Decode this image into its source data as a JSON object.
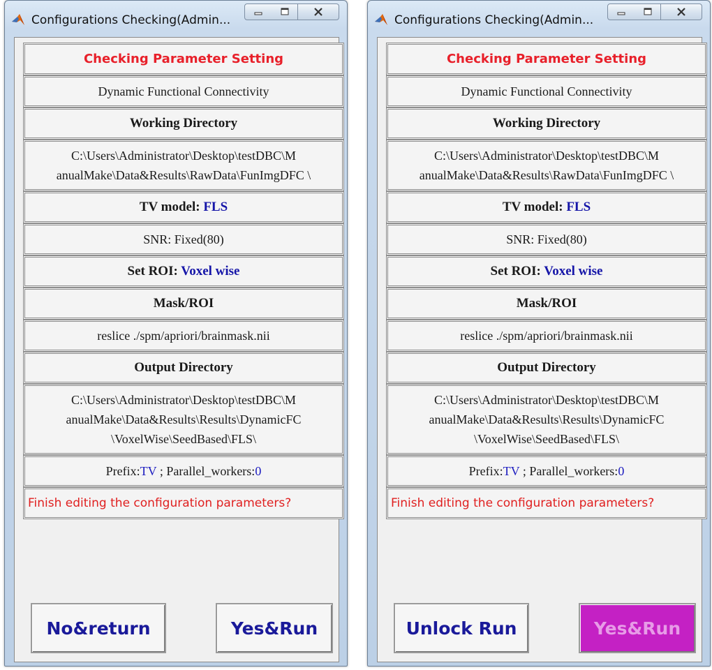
{
  "windows": [
    {
      "title": "Configurations Checking(Admin...",
      "header": "Checking Parameter Setting",
      "analysis_type": "Dynamic Functional Connectivity",
      "working_dir_label": "Working Directory",
      "working_dir_lines": [
        "C:\\Users\\Administrator\\Desktop\\testDBC\\M",
        "anualMake\\Data&Results\\RawData\\FunImgDFC \\"
      ],
      "tv_model_label": "TV model: ",
      "tv_model_value": "FLS",
      "snr": "SNR: Fixed(80)",
      "set_roi_label": "Set ROI: ",
      "set_roi_value": "Voxel wise",
      "mask_label": "Mask/ROI",
      "mask_value": "reslice ./spm/apriori/brainmask.nii",
      "output_dir_label": "Output Directory",
      "output_dir_lines": [
        "C:\\Users\\Administrator\\Desktop\\testDBC\\M",
        "anualMake\\Data&Results\\Results\\DynamicFC",
        "\\VoxelWise\\SeedBased\\FLS\\"
      ],
      "prefix_label": "Prefix:",
      "prefix_value": "TV",
      "workers_label": " ; Parallel_workers:",
      "workers_value": "0",
      "question": "Finish editing the configuration parameters?",
      "button_left": "No&return",
      "button_right": "Yes&Run"
    },
    {
      "title": "Configurations Checking(Admin...",
      "header": "Checking Parameter Setting",
      "analysis_type": "Dynamic Functional Connectivity",
      "working_dir_label": "Working Directory",
      "working_dir_lines": [
        "C:\\Users\\Administrator\\Desktop\\testDBC\\M",
        "anualMake\\Data&Results\\RawData\\FunImgDFC \\"
      ],
      "tv_model_label": "TV model: ",
      "tv_model_value": "FLS",
      "snr": "SNR: Fixed(80)",
      "set_roi_label": "Set ROI: ",
      "set_roi_value": "Voxel wise",
      "mask_label": "Mask/ROI",
      "mask_value": "reslice ./spm/apriori/brainmask.nii",
      "output_dir_label": "Output Directory",
      "output_dir_lines": [
        "C:\\Users\\Administrator\\Desktop\\testDBC\\M",
        "anualMake\\Data&Results\\Results\\DynamicFC",
        "\\VoxelWise\\SeedBased\\FLS\\"
      ],
      "prefix_label": "Prefix:",
      "prefix_value": "TV",
      "workers_label": " ; Parallel_workers:",
      "workers_value": "0",
      "question": "Finish editing the configuration parameters?",
      "button_left": "Unlock Run",
      "button_right": "Yes&Run",
      "button_right_disabled": true
    }
  ],
  "colors": {
    "title_red": "#e8202a",
    "value_blue": "#1515a8",
    "button_text": "#1a1a9a",
    "disabled_button_bg": "#c421c4",
    "disabled_button_text": "#e79be7"
  },
  "icons": {
    "app": "matlab-icon",
    "minimize": "minimize-icon",
    "maximize": "maximize-icon",
    "close": "close-icon"
  }
}
